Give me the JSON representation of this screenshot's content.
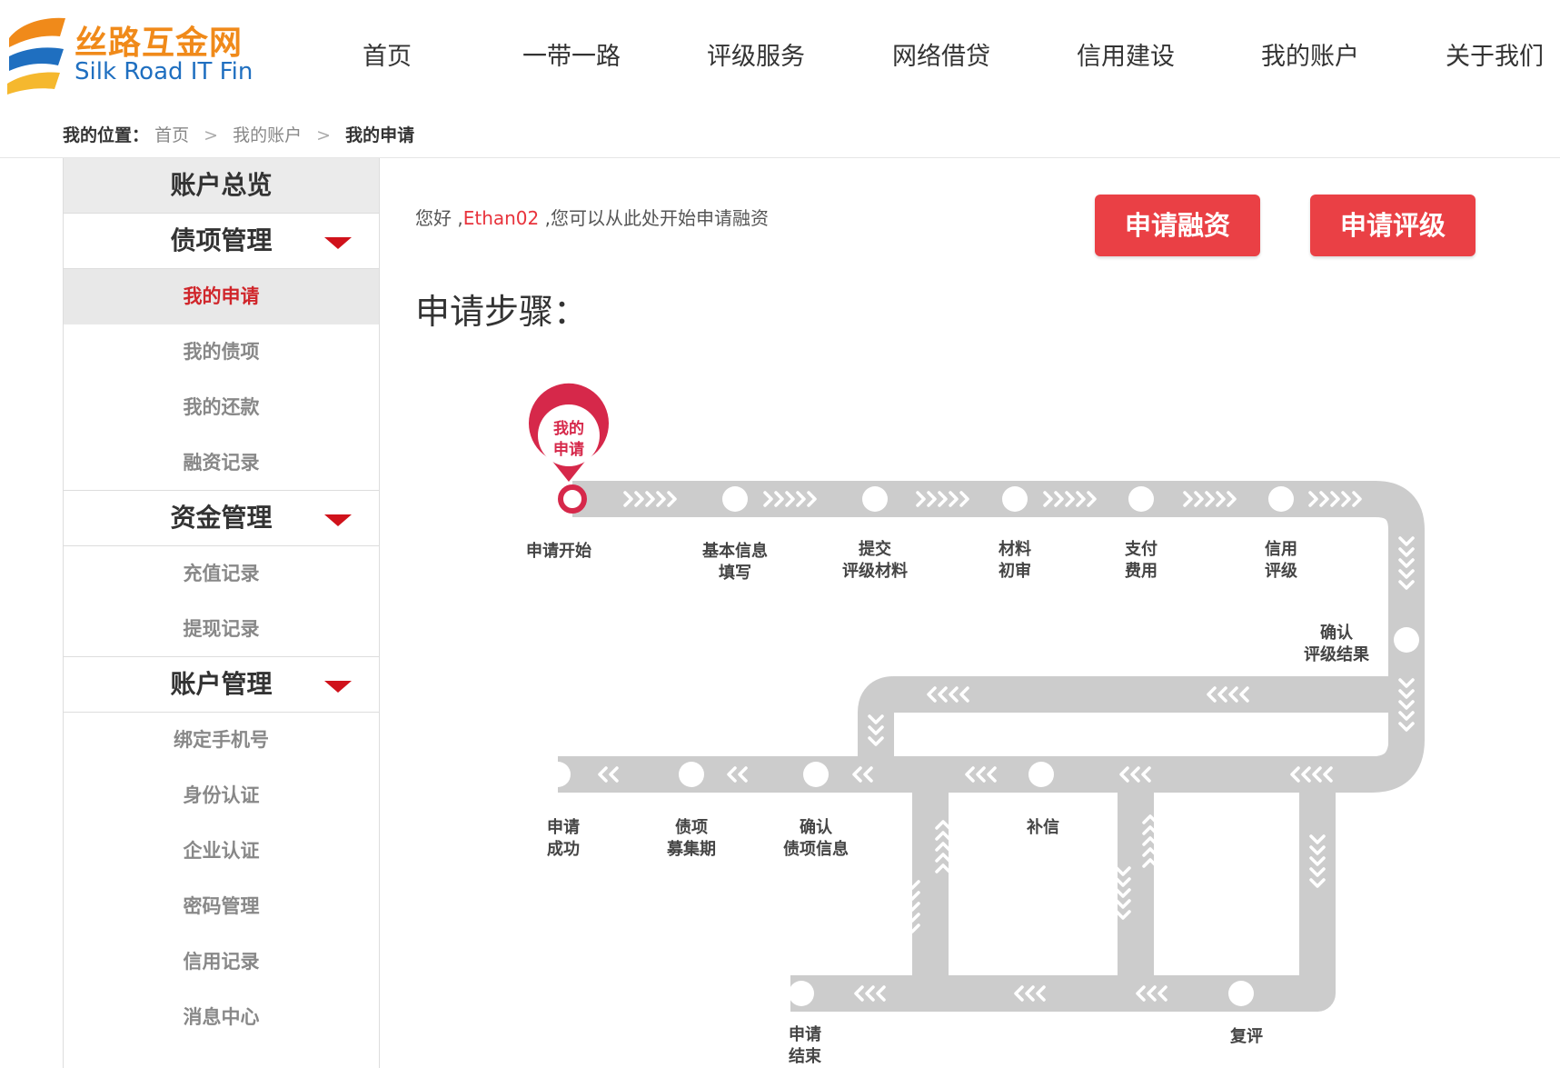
{
  "logo": {
    "name_cn": "丝路互金网",
    "name_en": "Silk Road IT Fin"
  },
  "nav": [
    "首页",
    "一带一路",
    "评级服务",
    "网络借贷",
    "信用建设",
    "我的账户",
    "关于我们"
  ],
  "breadcrumb": {
    "label": "我的位置：",
    "items": [
      "首页",
      "我的账户"
    ],
    "current": "我的申请",
    "separator": ">"
  },
  "sidebar": {
    "overview": "账户总览",
    "groups": [
      {
        "title": "债项管理",
        "items": [
          "我的申请",
          "我的债项",
          "我的还款",
          "融资记录"
        ]
      },
      {
        "title": "资金管理",
        "items": [
          "充值记录",
          "提现记录"
        ]
      },
      {
        "title": "账户管理",
        "items": [
          "绑定手机号",
          "身份认证",
          "企业认证",
          "密码管理",
          "信用记录",
          "消息中心"
        ]
      }
    ],
    "active_item": "我的申请"
  },
  "main": {
    "greeting_prefix": "您好 ,",
    "username": "Ethan02",
    "greeting_suffix": " ,您可以从此处开始申请融资",
    "apply_finance_button": "申请融资",
    "apply_rating_button": "申请评级",
    "steps_title": "申请步骤：",
    "marker": [
      "我的",
      "申请"
    ],
    "steps": {
      "start": [
        "申请开始"
      ],
      "basic_info": [
        "基本信息",
        "填写"
      ],
      "submit_materials": [
        "提交",
        "评级材料"
      ],
      "material_review": [
        "材料",
        "初审"
      ],
      "pay_fee": [
        "支付",
        "费用"
      ],
      "credit_rating": [
        "信用",
        "评级"
      ],
      "confirm_rating": [
        "确认",
        "评级结果"
      ],
      "success": [
        "申请",
        "成功"
      ],
      "raising_period": [
        "债项",
        "募集期"
      ],
      "confirm_debt": [
        "确认",
        "债项信息"
      ],
      "supplement": [
        "补信"
      ],
      "end": [
        "申请",
        "结束"
      ],
      "re_review": [
        "复评"
      ]
    }
  },
  "colors": {
    "accent": "#ea4045",
    "track": "#cccccc",
    "logo_orange": "#f08a1a",
    "logo_blue": "#1f6fc0"
  }
}
